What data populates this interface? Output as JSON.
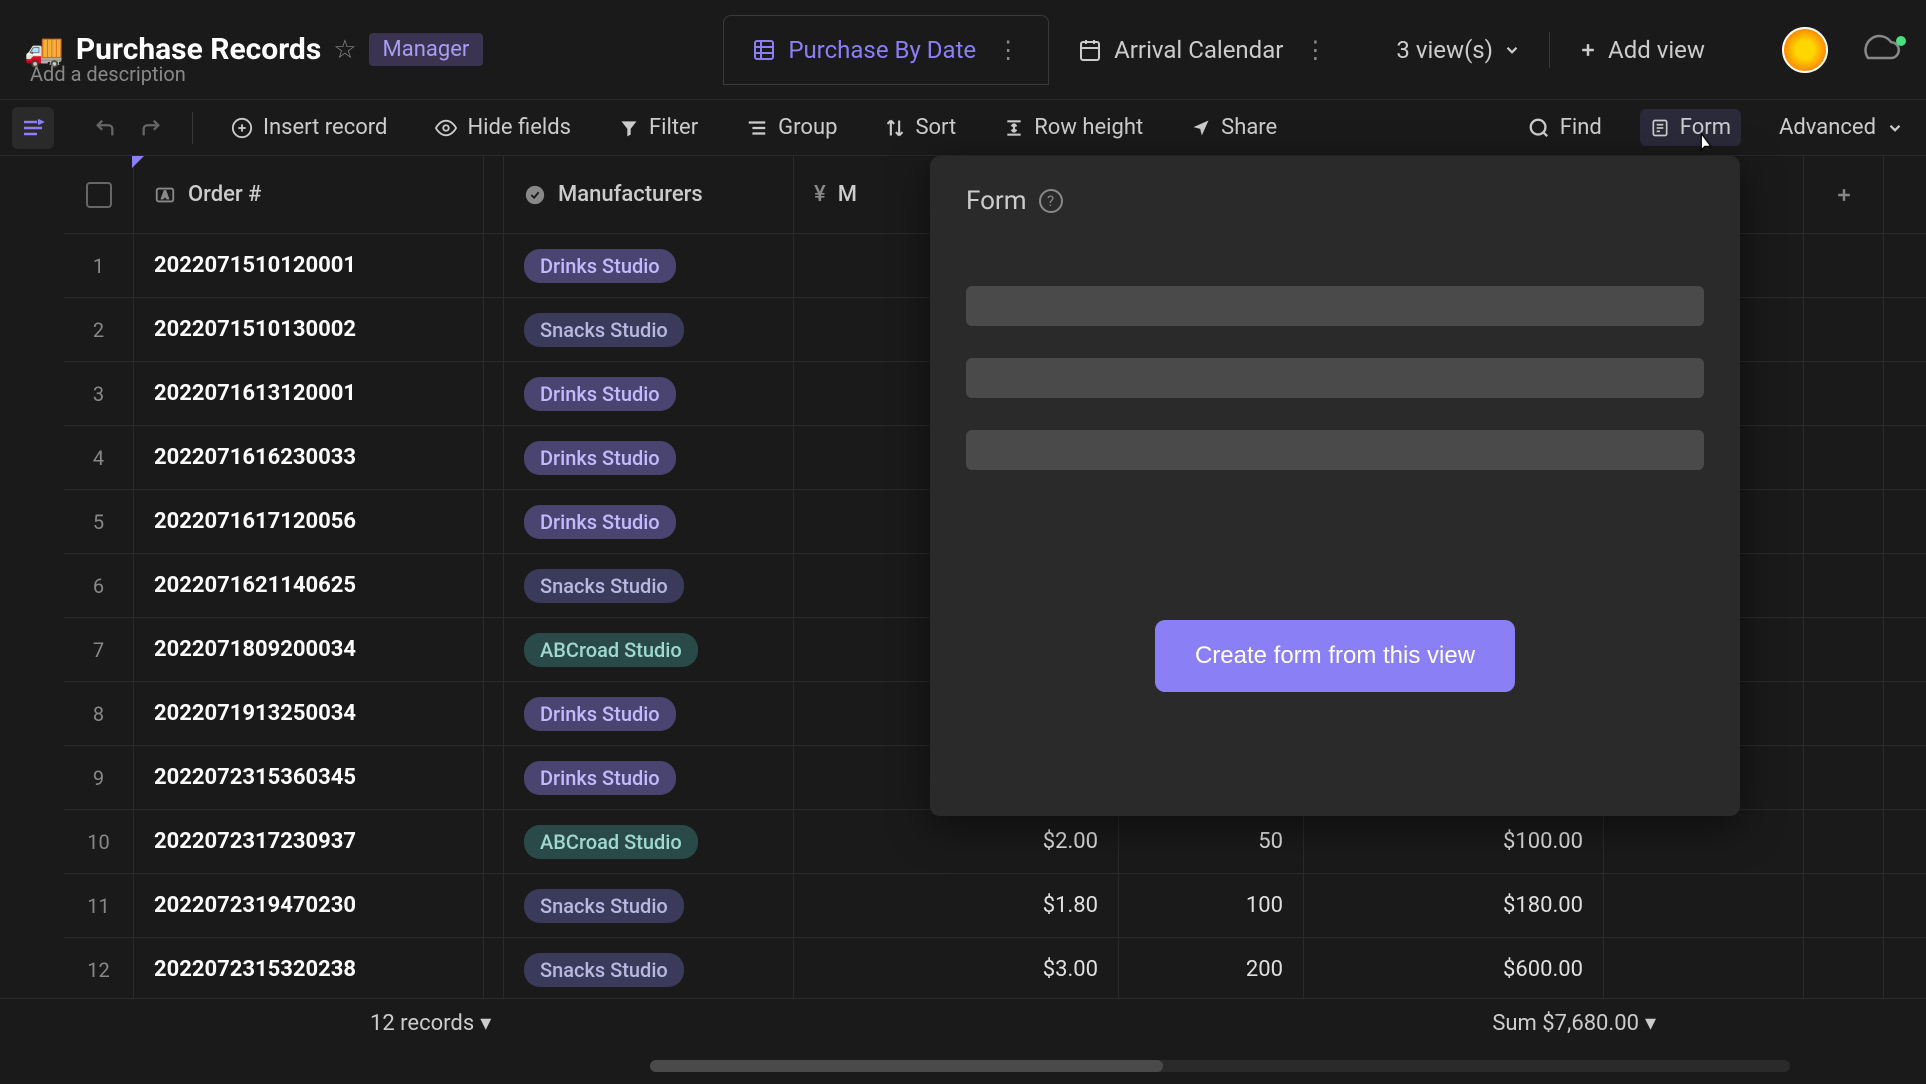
{
  "header": {
    "emoji": "🚚",
    "title": "Purchase Records",
    "badge": "Manager",
    "description_placeholder": "Add a description"
  },
  "views": {
    "tabs": [
      {
        "icon": "grid",
        "label": "Purchase By Date",
        "active": true
      },
      {
        "icon": "calendar",
        "label": "Arrival Calendar",
        "active": false
      }
    ],
    "count_label": "3 view(s)",
    "add_label": "Add view"
  },
  "toolbar": {
    "insert_record": "Insert record",
    "hide_fields": "Hide fields",
    "filter": "Filter",
    "group": "Group",
    "sort": "Sort",
    "row_height": "Row height",
    "share": "Share",
    "find": "Find",
    "form": "Form",
    "advanced": "Advanced"
  },
  "columns": {
    "order": "Order #",
    "manufacturers": "Manufacturers",
    "msrp_partial": "M"
  },
  "rows": [
    {
      "n": "1",
      "order": "2022071510120001",
      "mfr": "Drinks Studio",
      "mfr_tag": "drinks"
    },
    {
      "n": "2",
      "order": "2022071510130002",
      "mfr": "Snacks Studio",
      "mfr_tag": "snacks"
    },
    {
      "n": "3",
      "order": "2022071613120001",
      "mfr": "Drinks Studio",
      "mfr_tag": "drinks"
    },
    {
      "n": "4",
      "order": "2022071616230033",
      "mfr": "Drinks Studio",
      "mfr_tag": "drinks"
    },
    {
      "n": "5",
      "order": "2022071617120056",
      "mfr": "Drinks Studio",
      "mfr_tag": "drinks"
    },
    {
      "n": "6",
      "order": "2022071621140625",
      "mfr": "Snacks Studio",
      "mfr_tag": "snacks"
    },
    {
      "n": "7",
      "order": "2022071809200034",
      "mfr": "ABCroad Studio",
      "mfr_tag": "abcroad"
    },
    {
      "n": "8",
      "order": "2022071913250034",
      "mfr": "Drinks Studio",
      "mfr_tag": "drinks"
    },
    {
      "n": "9",
      "order": "2022072315360345",
      "mfr": "Drinks Studio",
      "mfr_tag": "drinks"
    },
    {
      "n": "10",
      "order": "2022072317230937",
      "mfr": "ABCroad Studio",
      "mfr_tag": "abcroad",
      "price": "$2.00",
      "qty": "50",
      "total": "$100.00"
    },
    {
      "n": "11",
      "order": "2022072319470230",
      "mfr": "Snacks Studio",
      "mfr_tag": "snacks",
      "price": "$1.80",
      "qty": "100",
      "total": "$180.00"
    },
    {
      "n": "12",
      "order": "2022072315320238",
      "mfr": "Snacks Studio",
      "mfr_tag": "snacks",
      "price": "$3.00",
      "qty": "200",
      "total": "$600.00"
    }
  ],
  "form_popup": {
    "title": "Form",
    "create_button": "Create form from this view"
  },
  "footer": {
    "records": "12 records",
    "sum": "Sum $7,680.00"
  }
}
